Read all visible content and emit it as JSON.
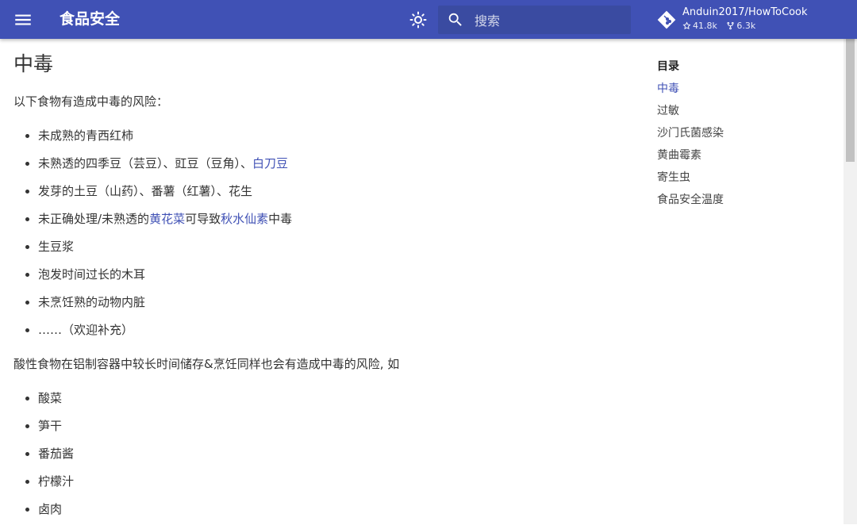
{
  "header": {
    "site_title": "食品安全",
    "search_placeholder": "搜索",
    "repo_name": "Anduin2017/HowToCook",
    "stars": "41.8k",
    "forks": "6.3k"
  },
  "main": {
    "title": "中毒",
    "intro": "以下食物有造成中毒的风险：",
    "list1": [
      {
        "text": "未成熟的青西红柿"
      },
      {
        "pre": "未熟透的四季豆（芸豆）、豇豆（豆角）、",
        "link": "白刀豆"
      },
      {
        "text": "发芽的土豆（山药）、番薯（红薯）、花生"
      },
      {
        "pre": "未正确处理/未熟透的",
        "link1": "黄花菜",
        "mid": "可导致",
        "link2": "秋水仙素",
        "post": "中毒"
      },
      {
        "text": "生豆浆"
      },
      {
        "text": "泡发时间过长的木耳"
      },
      {
        "text": "未烹饪熟的动物内脏"
      },
      {
        "text": "……（欢迎补充）"
      }
    ],
    "para2": "酸性食物在铝制容器中较长时间储存&烹饪同样也会有造成中毒的风险, 如",
    "list2": [
      "酸菜",
      "笋干",
      "番茄酱",
      "柠檬汁",
      "卤肉"
    ]
  },
  "toc": {
    "title": "目录",
    "items": [
      "中毒",
      "过敏",
      "沙门氏菌感染",
      "黄曲霉素",
      "寄生虫",
      "食品安全温度"
    ]
  },
  "colors": {
    "primary": "#4051b5",
    "link": "#4051b5",
    "text": "#333333"
  }
}
